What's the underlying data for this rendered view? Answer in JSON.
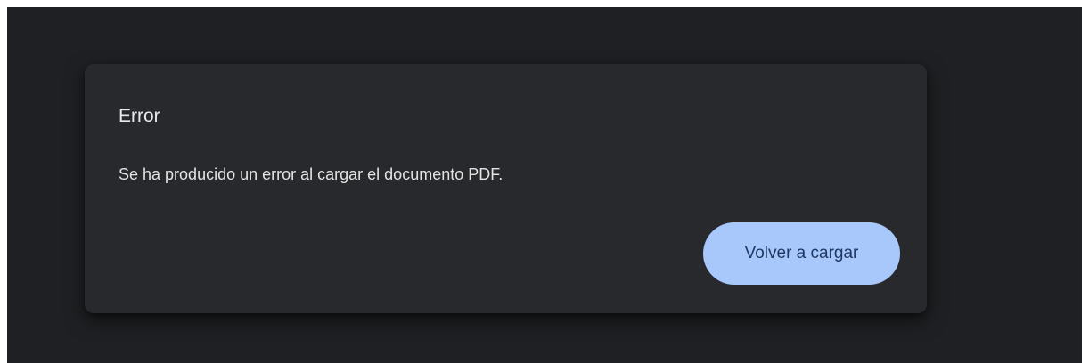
{
  "dialog": {
    "title": "Error",
    "message": "Se ha producido un error al cargar el documento PDF.",
    "reload_label": "Volver a cargar"
  },
  "colors": {
    "background": "#1f2023",
    "dialog_background": "#28292c",
    "button_background": "#a8c7fa",
    "button_text": "#1f3864",
    "text": "#e8eaed"
  }
}
